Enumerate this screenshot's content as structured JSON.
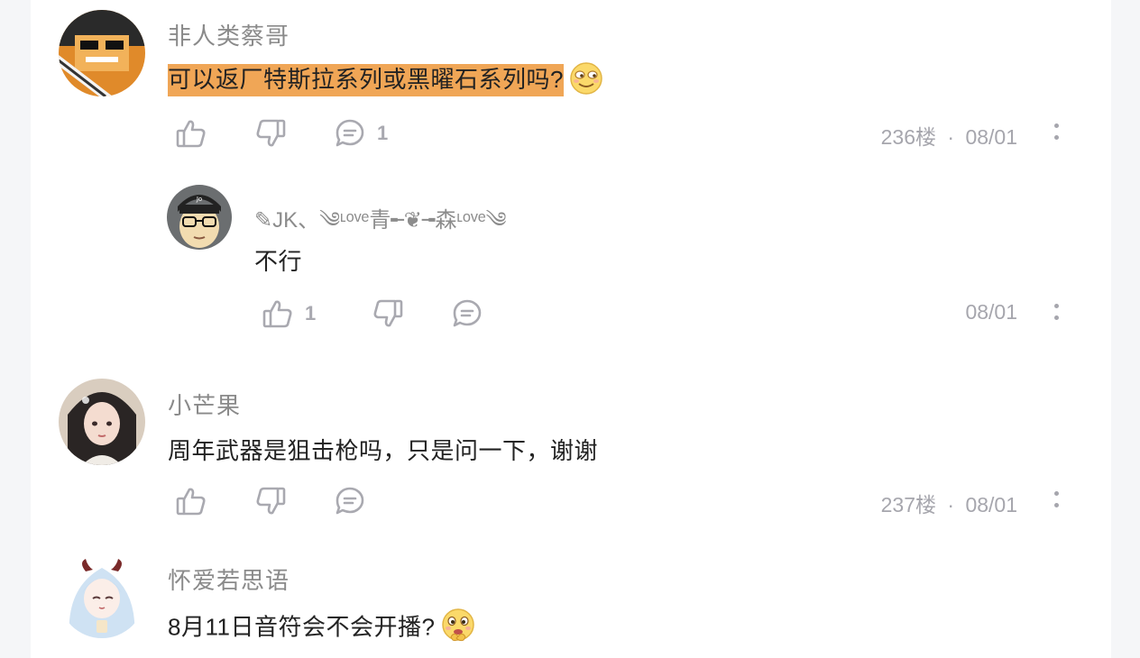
{
  "comments": [
    {
      "username": "非人类蔡哥",
      "text": "可以返厂特斯拉系列或黑曜石系列吗?",
      "emoji": "smirk-face",
      "reply_count": "1",
      "floor": "236楼",
      "separator": "·",
      "date": "08/01",
      "reply": {
        "username": "✎JK、༄ᶫᵒᵛᵉ青╾❦╼森ᶫᵒᵛᵉ༄",
        "text": "不行",
        "like_count": "1",
        "date": "08/01"
      }
    },
    {
      "username": "小芒果",
      "text": "周年武器是狙击枪吗，只是问一下，谢谢",
      "floor": "237楼",
      "separator": "·",
      "date": "08/01"
    },
    {
      "username": "怀爱若思语",
      "text": "8月11日音符会不会开播?",
      "emoji": "thinking-face"
    }
  ],
  "colors": {
    "highlight": "#f0a656",
    "icon_gray": "#a9a9b0",
    "username_gray": "#8a8a8a"
  }
}
